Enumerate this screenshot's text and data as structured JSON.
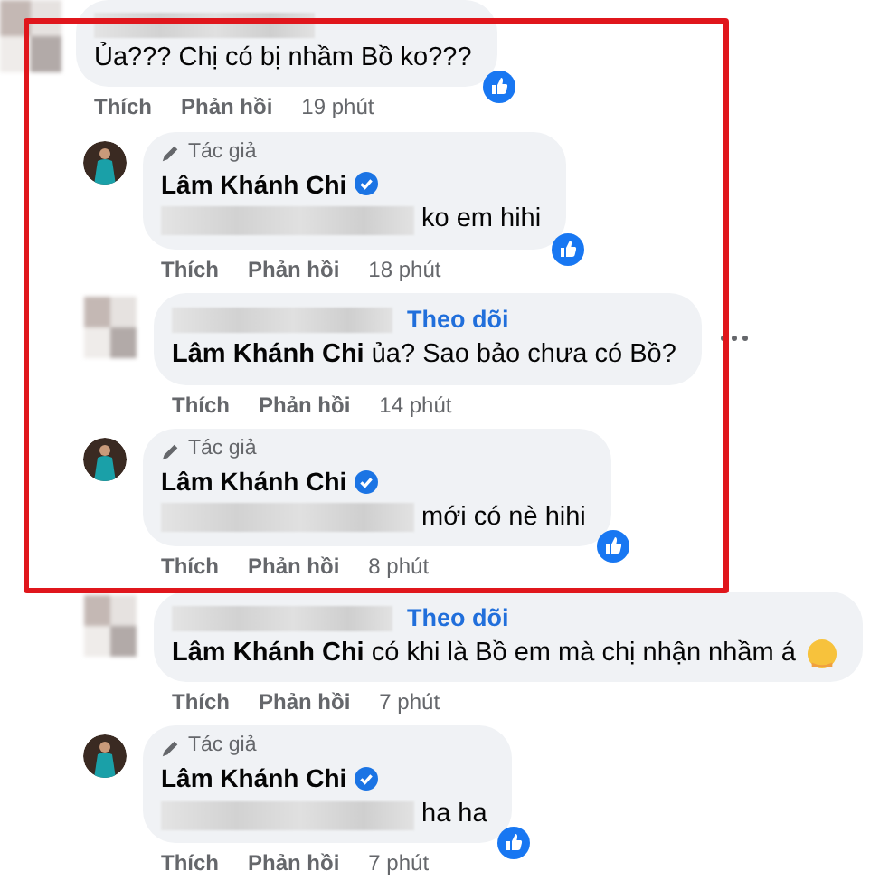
{
  "highlight_frame": true,
  "comments": [
    {
      "kind": "visitor",
      "name_redacted": true,
      "text": "Ủa??? Chị có bị nhầm Bồ ko???",
      "liked": true,
      "actions": [
        "Thích",
        "Phản hồi"
      ],
      "time": "19 phút",
      "replies": [
        {
          "kind": "author",
          "role": "Tác giả",
          "author": "Lâm Khánh Chi",
          "verified": true,
          "text_redacted": true,
          "text": "ko em hihi",
          "liked": true,
          "actions": [
            "Thích",
            "Phản hồi"
          ],
          "time": "18 phút"
        },
        {
          "kind": "visitor",
          "name_redacted": true,
          "follow_label": "Theo dõi",
          "text": "**Lâm Khánh Chi** ủa? Sao bảo chưa có Bồ?",
          "more_button": true,
          "actions": [
            "Thích",
            "Phản hồi"
          ],
          "time": "14 phút"
        },
        {
          "kind": "author",
          "role": "Tác giả",
          "author": "Lâm Khánh Chi",
          "verified": true,
          "text_redacted": true,
          "text": "mới có nè hihi",
          "liked": true,
          "actions": [
            "Thích",
            "Phản hồi"
          ],
          "time": "8 phút"
        },
        {
          "kind": "visitor",
          "name_redacted": true,
          "follow_label": "Theo dõi",
          "text": "**Lâm Khánh Chi** có khi là Bồ em mà chị nhận nhầm á",
          "emoji": true,
          "actions": [
            "Thích",
            "Phản hồi"
          ],
          "time": "7 phút"
        },
        {
          "kind": "author",
          "role": "Tác giả",
          "author": "Lâm Khánh Chi",
          "verified": true,
          "text_redacted": true,
          "text": "ha ha",
          "liked": true,
          "actions": [
            "Thích",
            "Phản hồi"
          ],
          "time": "7 phút"
        }
      ]
    }
  ]
}
